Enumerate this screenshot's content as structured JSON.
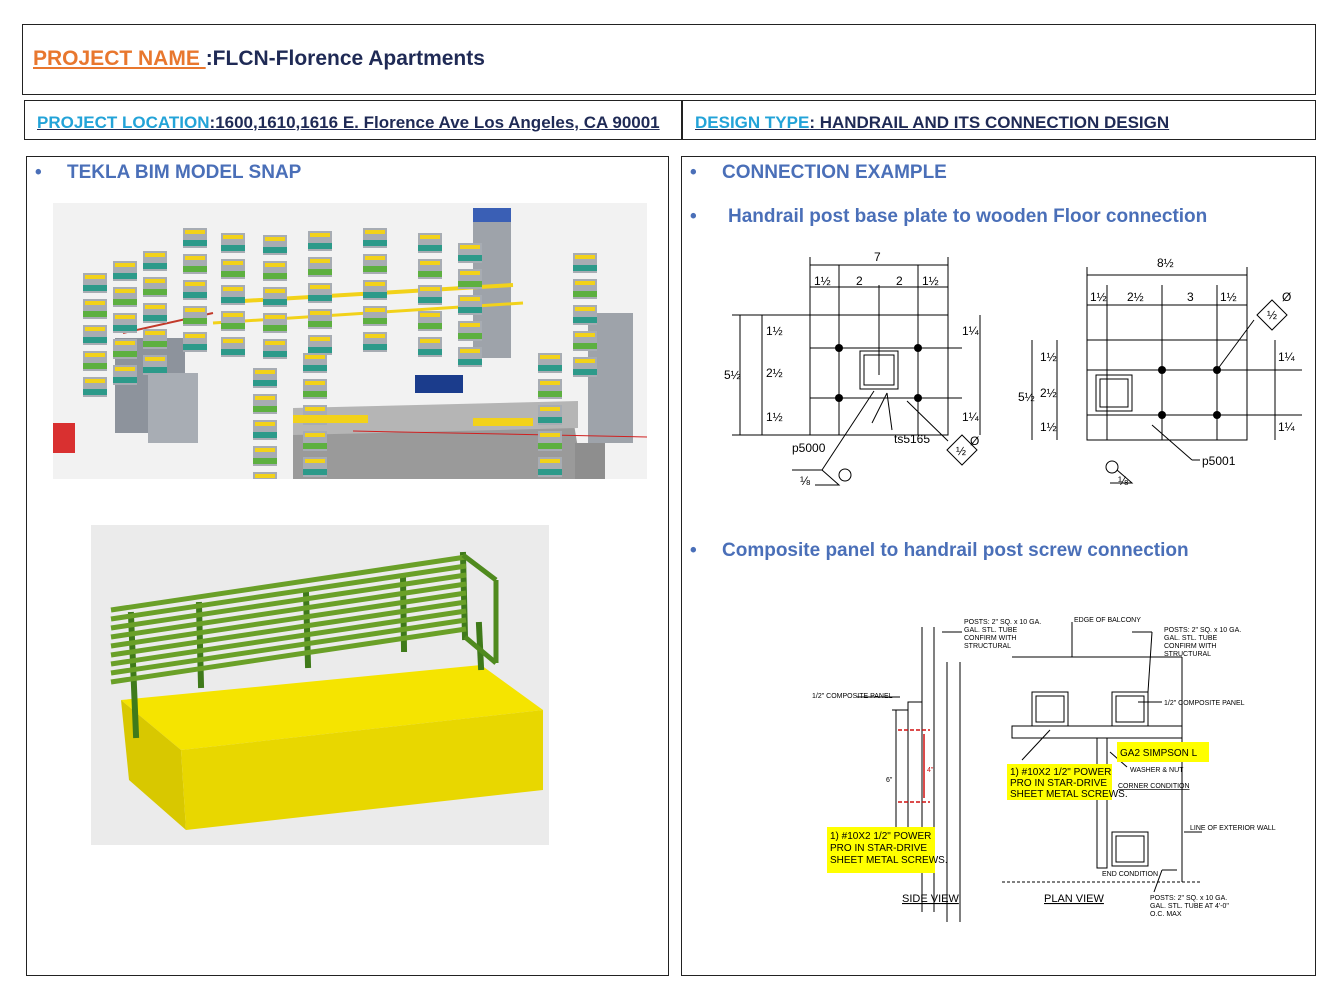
{
  "header": {
    "project_label": "PROJECT NAME ",
    "project_value": ":FLCN-Florence Apartments",
    "location_label": "PROJECT LOCATION",
    "location_value": ":1600,1610,1616 E. Florence Ave Los Angeles, CA 90001",
    "design_label": "DESIGN TYPE",
    "design_value": ": HANDRAIL AND ITS CONNECTION DESIGN"
  },
  "left": {
    "bullet": "TEKLA BIM MODEL SNAP"
  },
  "right": {
    "bullet1": "CONNECTION EXAMPLE",
    "bullet2": "Handrail post base plate to wooden Floor connection",
    "bullet3": "Composite panel to handrail post screw connection"
  },
  "drawing1": {
    "dim_top_a": "7",
    "dim_a1": "1½",
    "dim_a2": "2",
    "dim_a3": "2",
    "dim_a4": "1½",
    "dim_left": "5½",
    "dim_l1": "1½",
    "dim_l2": "2½",
    "dim_l3": "1½",
    "dim_r1": "1¼",
    "dim_r2": "1¼",
    "label_plate": "p5000",
    "label_tube": "ts5165",
    "weld_a": "⅛",
    "weld_b": "½",
    "weld_sym": "Ø",
    "dim_top_b": "8½",
    "dim_b1": "1½",
    "dim_b2": "2½",
    "dim_b3": "3",
    "dim_b4": "1½",
    "dim_left_b": "5½",
    "dim_lb1": "1½",
    "dim_lb2": "2½",
    "dim_lb3": "1½",
    "dim_rb1": "1¼",
    "dim_rb2": "1¼",
    "label_plate_b": "p5001",
    "weld_b2": "⅛",
    "weld_b3": "½",
    "weld_sym_b": "Ø"
  },
  "drawing2": {
    "posts_note_a": "POSTS: 2\" SQ. x 10 GA.",
    "posts_note_a2": "GAL. STL. TUBE",
    "posts_note_a3": "CONFIRM WITH",
    "posts_note_a4": "STRUCTURAL",
    "panel_note": "1/2\" COMPOSITE PANEL",
    "dim_6": "6\"",
    "dim_4": "4\"",
    "screw_note_1": "1)   #10X2 1/2\" POWER",
    "screw_note_2": "PRO IN STAR-DRIVE",
    "screw_note_3": "SHEET METAL SCREWS.",
    "side_view": "SIDE  VIEW",
    "edge_note": "EDGE OF BALCONY",
    "posts_note_b": "POSTS: 2\" SQ. x 10 GA.",
    "posts_note_b2": "GAL. STL. TUBE",
    "posts_note_b3": "CONFIRM WITH",
    "posts_note_b4": "STRUCTURAL",
    "panel_note_b": "1/2\" COMPOSITE PANEL",
    "simpson": "GA2 SIMPSON L",
    "screw_note_b1": "1)   #10X2 1/2\" POWER",
    "screw_note_b2": "PRO IN STAR-DRIVE",
    "screw_note_b3": "SHEET METAL SCREWS.",
    "washer": "WASHER & NUT",
    "corner": "CORNER CONDITION",
    "ext_wall": "LINE OF EXTERIOR WALL",
    "end_cond": "END CONDITION",
    "plan_view": "PLAN  VIEW",
    "posts_note_c1": "POSTS: 2\" SQ. x 10 GA.",
    "posts_note_c2": "GAL. STL. TUBE AT 4'-0\"",
    "posts_note_c3": "O.C. MAX"
  }
}
